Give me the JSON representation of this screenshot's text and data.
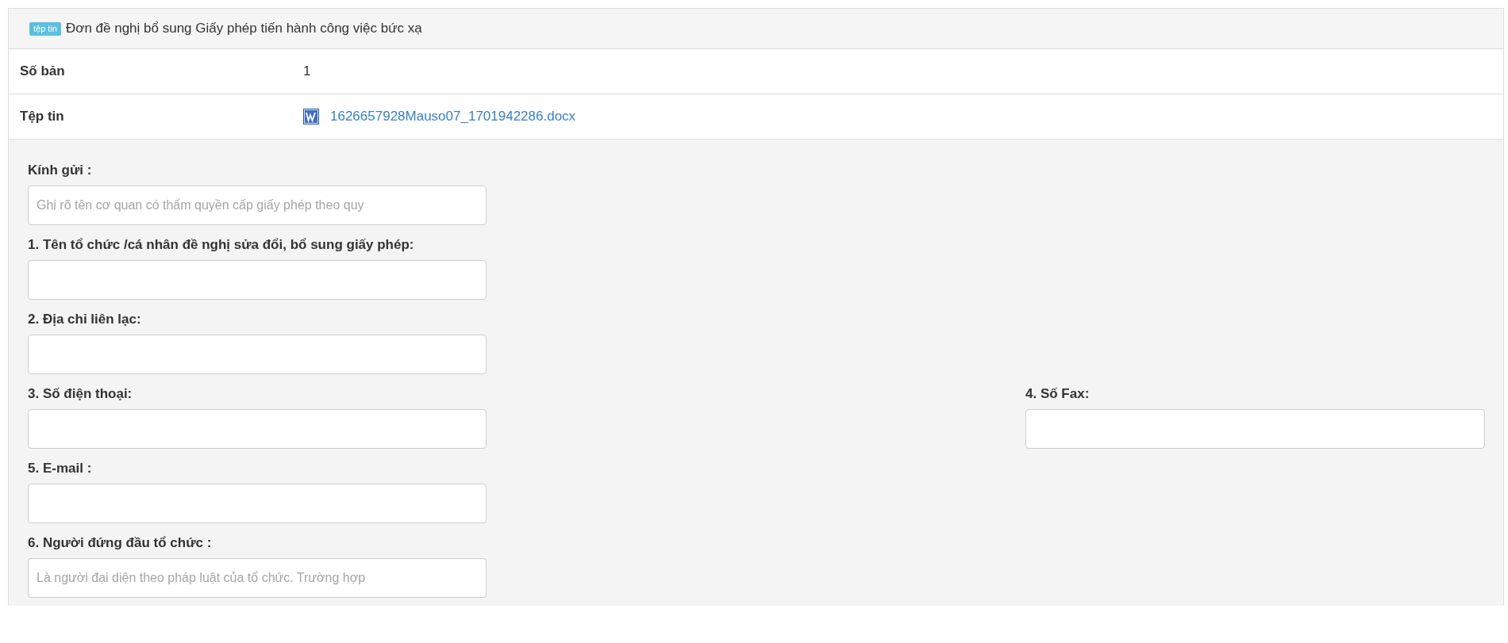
{
  "header": {
    "badge": "tệp tin",
    "title": "Đơn đề nghị bổ sung Giấy phép tiến hành công việc bức xạ"
  },
  "info_rows": [
    {
      "label": "Số bản",
      "value": "1",
      "kind": "text"
    },
    {
      "label": "Tệp tin",
      "value": "1626657928Mauso07_1701942286.docx",
      "kind": "file"
    }
  ],
  "form": {
    "rows": [
      [
        {
          "label": "Kính gửi :",
          "placeholder": "Ghi rõ tên cơ quan có thẩm quyền cấp giấy phép theo quy"
        }
      ],
      [
        {
          "label": "1. Tên tổ chức /cá nhân đề nghị sửa đổi, bổ sung giấy phép:"
        }
      ],
      [
        {
          "label": "2. Địa chỉ liên lạc:"
        }
      ],
      [
        {
          "label": "3. Số điện thoại:"
        },
        {
          "label": "4. Số Fax:"
        }
      ],
      [
        {
          "label": "5. E-mail :"
        }
      ],
      [
        {
          "label": "6. Người đứng đầu tổ chức :",
          "placeholder": "Là người đại diện theo pháp luật của tổ chức. Trường hợp"
        }
      ]
    ]
  }
}
